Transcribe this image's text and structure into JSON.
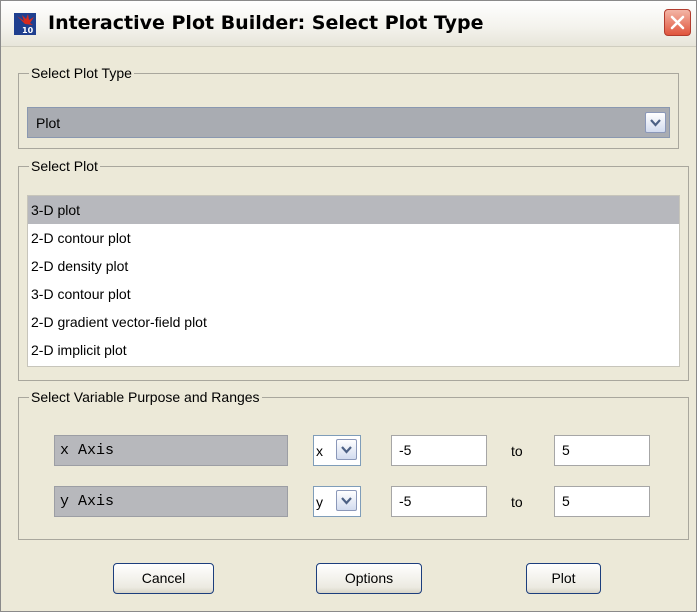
{
  "window": {
    "title": "Interactive Plot Builder: Select Plot Type"
  },
  "plot_type_group": {
    "legend": "Select Plot Type",
    "selected": "Plot"
  },
  "plot_group": {
    "legend": "Select Plot",
    "items": [
      "3-D plot",
      "2-D contour plot",
      "2-D density plot",
      "3-D contour plot",
      "2-D gradient vector-field plot",
      "2-D implicit plot"
    ],
    "selected_index": 0
  },
  "variables_group": {
    "legend": "Select Variable Purpose and Ranges",
    "rows": [
      {
        "purpose": "x Axis",
        "variable": "x",
        "from": "-5",
        "to_label": "to",
        "to": "5"
      },
      {
        "purpose": "y Axis",
        "variable": "y",
        "from": "-5",
        "to_label": "to",
        "to": "5"
      }
    ]
  },
  "buttons": {
    "cancel": "Cancel",
    "options": "Options",
    "plot": "Plot"
  },
  "icons": {
    "app": "maple-icon",
    "close": "close-icon",
    "dropdown": "chevron-down-icon"
  },
  "colors": {
    "close_button": "#e0553d",
    "selection": "#b7b8bd"
  }
}
